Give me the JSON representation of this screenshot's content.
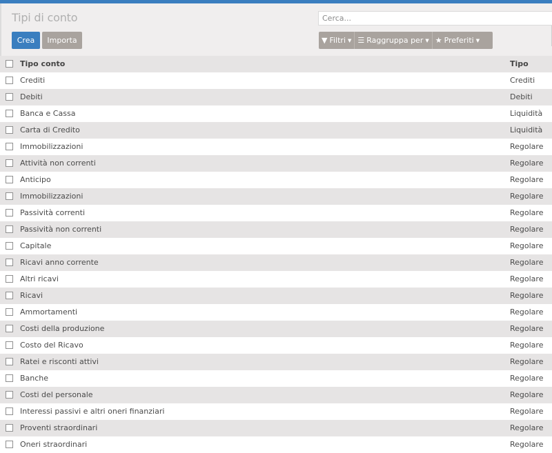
{
  "page": {
    "title": "Tipi di conto",
    "search_placeholder": "Cerca..."
  },
  "buttons": {
    "crea": "Crea",
    "importa": "Importa"
  },
  "filters": {
    "filtri": "Filtri",
    "raggruppa": "Raggruppa per",
    "preferiti": "Preferiti"
  },
  "table": {
    "headers": {
      "name": "Tipo conto",
      "type": "Tipo"
    },
    "rows": [
      {
        "name": "Crediti",
        "type": "Crediti"
      },
      {
        "name": "Debiti",
        "type": "Debiti"
      },
      {
        "name": "Banca e Cassa",
        "type": "Liquidità"
      },
      {
        "name": "Carta di Credito",
        "type": "Liquidità"
      },
      {
        "name": "Immobilizzazioni",
        "type": "Regolare"
      },
      {
        "name": "Attività non correnti",
        "type": "Regolare"
      },
      {
        "name": "Anticipo",
        "type": "Regolare"
      },
      {
        "name": "Immobilizzazioni",
        "type": "Regolare"
      },
      {
        "name": "Passività correnti",
        "type": "Regolare"
      },
      {
        "name": "Passività non correnti",
        "type": "Regolare"
      },
      {
        "name": "Capitale",
        "type": "Regolare"
      },
      {
        "name": "Ricavi anno corrente",
        "type": "Regolare"
      },
      {
        "name": "Altri ricavi",
        "type": "Regolare"
      },
      {
        "name": "Ricavi",
        "type": "Regolare"
      },
      {
        "name": "Ammortamenti",
        "type": "Regolare"
      },
      {
        "name": "Costi della produzione",
        "type": "Regolare"
      },
      {
        "name": "Costo del Ricavo",
        "type": "Regolare"
      },
      {
        "name": "Ratei e risconti attivi",
        "type": "Regolare"
      },
      {
        "name": "Banche",
        "type": "Regolare"
      },
      {
        "name": "Costi del personale",
        "type": "Regolare"
      },
      {
        "name": "Interessi passivi e altri oneri finanziari",
        "type": "Regolare"
      },
      {
        "name": "Proventi straordinari",
        "type": "Regolare"
      },
      {
        "name": "Oneri straordinari",
        "type": "Regolare"
      }
    ]
  }
}
